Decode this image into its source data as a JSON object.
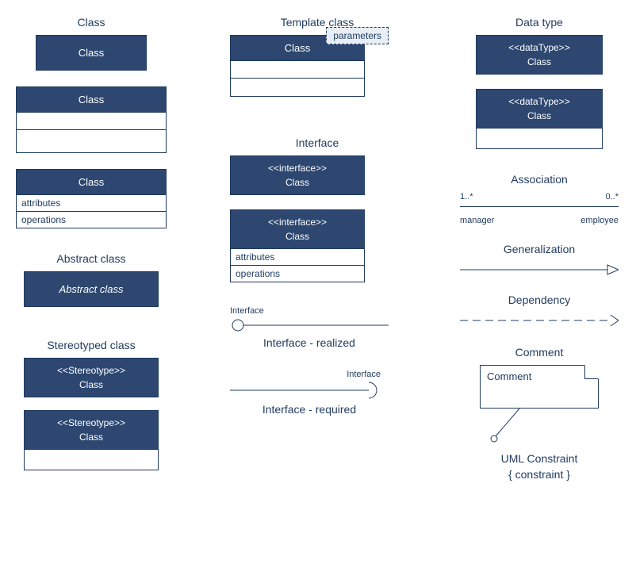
{
  "col1": {
    "class_title": "Class",
    "class_label": "Class",
    "attributes": "attributes",
    "operations": "operations",
    "abstract_title": "Abstract class",
    "abstract_label": "Abstract class",
    "stereo_title": "Stereotyped class",
    "stereo_tag": "<<Stereotype>>"
  },
  "col2": {
    "template_title": "Template class",
    "class_label": "Class",
    "parameters": "parameters",
    "interface_title": "Interface",
    "interface_tag": "<<interface>>",
    "attributes": "attributes",
    "operations": "operations",
    "iface_label": "Interface",
    "iface_realized": "Interface - realized",
    "iface_required": "Interface - required"
  },
  "col3": {
    "datatype_title": "Data type",
    "datatype_tag": "<<dataType>>",
    "class_label": "Class",
    "assoc_title": "Association",
    "assoc_lt": "1..*",
    "assoc_rt": "0..*",
    "assoc_lb": "manager",
    "assoc_rb": "employee",
    "gen_title": "Generalization",
    "dep_title": "Dependency",
    "comment_title": "Comment",
    "comment_text": "Comment",
    "constraint_title": "UML Constraint",
    "constraint_text": "{ constraint }"
  }
}
